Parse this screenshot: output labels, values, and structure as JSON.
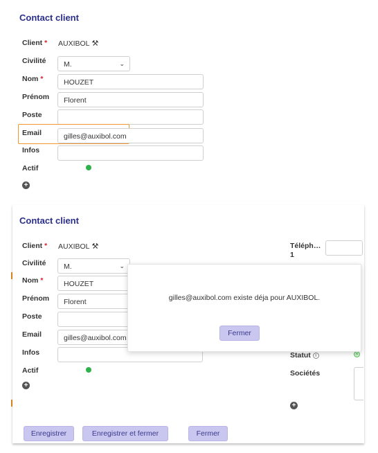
{
  "top": {
    "title": "Contact client",
    "labels": {
      "client": "Client",
      "civilite": "Civilité",
      "nom": "Nom",
      "prenom": "Prénom",
      "poste": "Poste",
      "email": "Email",
      "infos": "Infos",
      "actif": "Actif"
    },
    "required_mark": "*",
    "client_value": "AUXIBOL",
    "civilite_value": "M.",
    "nom_value": "HOUZET",
    "prenom_value": "Florent",
    "poste_value": "",
    "email_value": "gilles@auxibol.com",
    "infos_value": "",
    "actif_status": "active"
  },
  "bottom": {
    "title": "Contact client",
    "labels": {
      "client": "Client",
      "civilite": "Civilité",
      "nom": "Nom",
      "prenom": "Prénom",
      "poste": "Poste",
      "email": "Email",
      "infos": "Infos",
      "actif": "Actif"
    },
    "required_mark": "*",
    "client_value": "AUXIBOL",
    "civilite_value": "M.",
    "nom_value": "HOUZET",
    "prenom_value": "Florent",
    "email_value": "gilles@auxibol.com",
    "right": {
      "telephone_label": "Téléph… 1",
      "statut_label": "Statut",
      "societes_label": "Sociétés"
    },
    "buttons": {
      "save": "Enregistrer",
      "save_close": "Enregistrer et fermer",
      "close": "Fermer"
    },
    "modal": {
      "message": "gilles@auxibol.com existe déja pour AUXIBOL.",
      "close": "Fermer"
    }
  },
  "colors": {
    "accent": "#2b2f8a",
    "required": "#d9232e",
    "highlight": "#f0962e",
    "active": "#2fb14a",
    "button_bg": "#c9c6ef"
  },
  "icons": {
    "tool": "wrench-screwdriver-icon",
    "chevron": "chevron-down-icon",
    "add": "plus-circle-icon",
    "info": "info-icon"
  }
}
